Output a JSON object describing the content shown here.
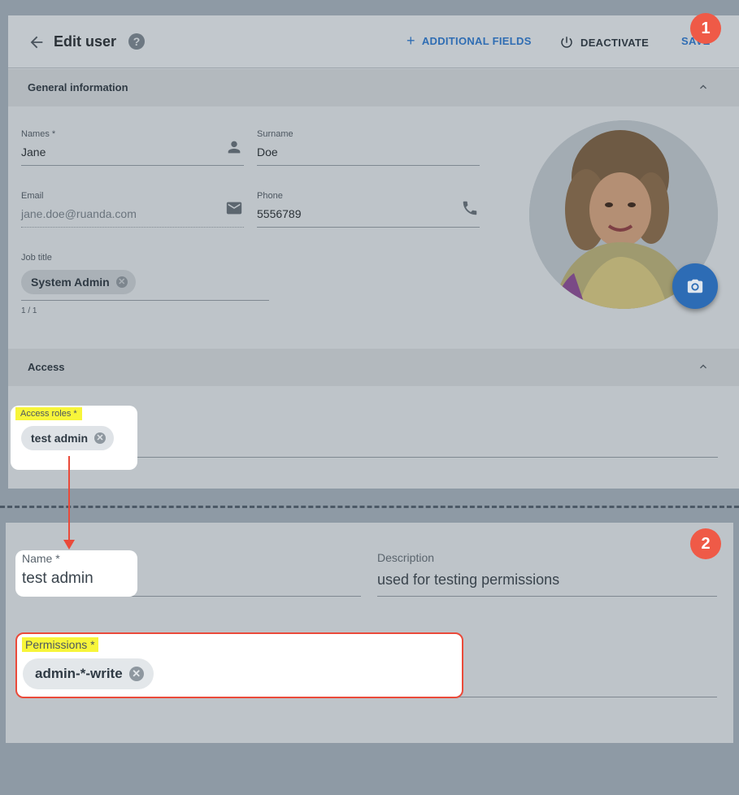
{
  "header": {
    "title": "Edit user",
    "help_glyph": "?",
    "additional_fields_label": "ADDITIONAL FIELDS",
    "deactivate_label": "DEACTIVATE",
    "save_label": "SAVE"
  },
  "general_info": {
    "section_label": "General information",
    "names_label": "Names *",
    "names_value": "Jane",
    "surname_label": "Surname",
    "surname_value": "Doe",
    "email_label": "Email",
    "email_value": "jane.doe@ruanda.com",
    "phone_label": "Phone",
    "phone_value": "5556789",
    "job_title_label": "Job title",
    "job_title_chip": "System Admin",
    "job_title_counter": "1 / 1"
  },
  "access": {
    "section_label": "Access",
    "roles_label": "Access roles *",
    "roles_chip": "test admin"
  },
  "role_detail": {
    "name_label": "Name *",
    "name_value": "test admin",
    "description_label": "Description",
    "description_value": "used for testing permissions",
    "permissions_label": "Permissions *",
    "permissions_chip": "admin-*-write"
  },
  "badges": {
    "one": "1",
    "two": "2"
  },
  "colors": {
    "accent_blue": "#2f6db3",
    "callout_red": "#ea4a3a",
    "highlight_yellow": "#f7f53a",
    "badge_red": "#ef5a47"
  },
  "icons": [
    "back-arrow-icon",
    "help-icon",
    "plus-icon",
    "power-icon",
    "person-icon",
    "envelope-icon",
    "phone-icon",
    "chevron-up-icon",
    "camera-icon",
    "chip-remove-icon"
  ]
}
